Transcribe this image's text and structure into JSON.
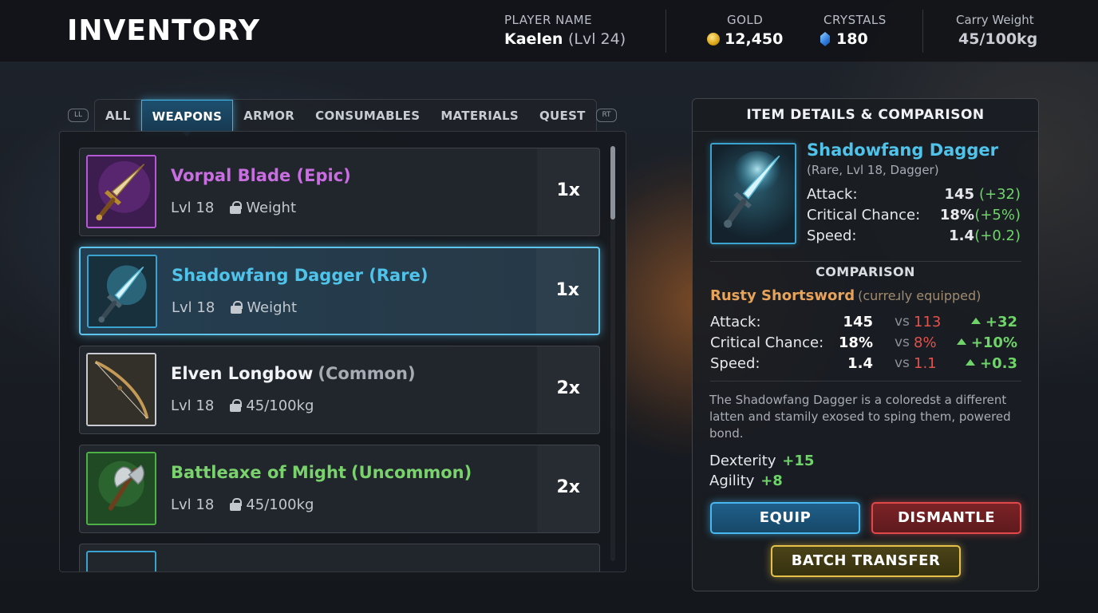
{
  "header": {
    "title": "INVENTORY",
    "player_label": "PLAYER NAME",
    "player_name": "Kaelen",
    "player_level": "(Lvl 24)",
    "gold_label": "GOLD",
    "gold_value": "12,450",
    "crystals_label": "CRYSTALS",
    "crystals_value": "180",
    "weight_label": "Carry Weight",
    "weight_value": "45/100kg",
    "icons": {
      "gold": "gold-coin-icon",
      "crystals": "crystal-icon"
    }
  },
  "bumpers": {
    "left": "LL",
    "right": "RT"
  },
  "tabs": [
    {
      "label": "ALL",
      "active": false
    },
    {
      "label": "WEAPONS",
      "active": true
    },
    {
      "label": "ARMOR",
      "active": false
    },
    {
      "label": "CONSUMABLES",
      "active": false
    },
    {
      "label": "MATERIALS",
      "active": false
    },
    {
      "label": "QUEST",
      "active": false
    }
  ],
  "items": [
    {
      "name": "Vorpal Blade (Epic)",
      "name_color": "#c86ee0",
      "rarity_suffix": "",
      "level": "Lvl 18",
      "weight": "Weight",
      "qty": "1x",
      "icon": "sword-icon",
      "frame_color": "#b45ad6",
      "selected": false
    },
    {
      "name": "Shadowfang Dagger (Rare)",
      "name_color": "#4fc3ea",
      "rarity_suffix": "",
      "level": "Lvl 18",
      "weight": "Weight",
      "qty": "1x",
      "icon": "dagger-icon",
      "frame_color": "#3aa3cf",
      "selected": true
    },
    {
      "name": "Elven Longbow",
      "name_color": "#f0f2f5",
      "rarity_suffix": "(Common)",
      "suffix_color": "#a7acb4",
      "level": "Lvl 18",
      "weight": "45/100kg",
      "qty": "2x",
      "icon": "bow-icon",
      "frame_color": "#c8ccd2",
      "selected": false
    },
    {
      "name": "Battleaxe of Might",
      "name_color": "#79d26c",
      "rarity_suffix": "(Uncommon)",
      "suffix_color": "#79d26c",
      "level": "Lvl 18",
      "weight": "45/100kg",
      "qty": "2x",
      "icon": "axe-icon",
      "frame_color": "#4fb048",
      "selected": false
    }
  ],
  "details": {
    "title": "ITEM DETAILS & COMPARISON",
    "name": "Shadowfang Dagger",
    "subtitle": "(Rare, Lvl 18, Dagger)",
    "stats": [
      {
        "label": "Attack:",
        "value": "145",
        "bonus": "(+32)"
      },
      {
        "label": "Critical Chance:",
        "value": "18%",
        "bonus": "(+5%)"
      },
      {
        "label": "Speed:",
        "value": "1.4",
        "bonus": "(+0.2)"
      }
    ],
    "comparison_title": "COMPARISON",
    "compare_item": "Rusty Shortsword",
    "compare_note": "(curreɹly equipped)",
    "comparison": [
      {
        "label": "Attack:",
        "a": "145",
        "vs": "vs",
        "b": "113",
        "delta": "+32"
      },
      {
        "label": "Critical Chance:",
        "a": "18%",
        "vs": "vs",
        "b": "8%",
        "delta": "+10%"
      },
      {
        "label": "Speed:",
        "a": "1.4",
        "vs": "vs",
        "b": "1.1",
        "delta": "+0.3"
      }
    ],
    "description": "The Shadowfang Dagger is a coloredsŧ a different latten and stamily exosed to sping them, powered bond.",
    "attributes": [
      {
        "label": "Dexterity",
        "value": "+15"
      },
      {
        "label": "Agility",
        "value": "+8"
      }
    ],
    "buttons": {
      "equip": "EQUIP",
      "dismantle": "DISMANTLE",
      "batch": "BATCH TRANSFER"
    }
  },
  "scroll_position": 0.0
}
